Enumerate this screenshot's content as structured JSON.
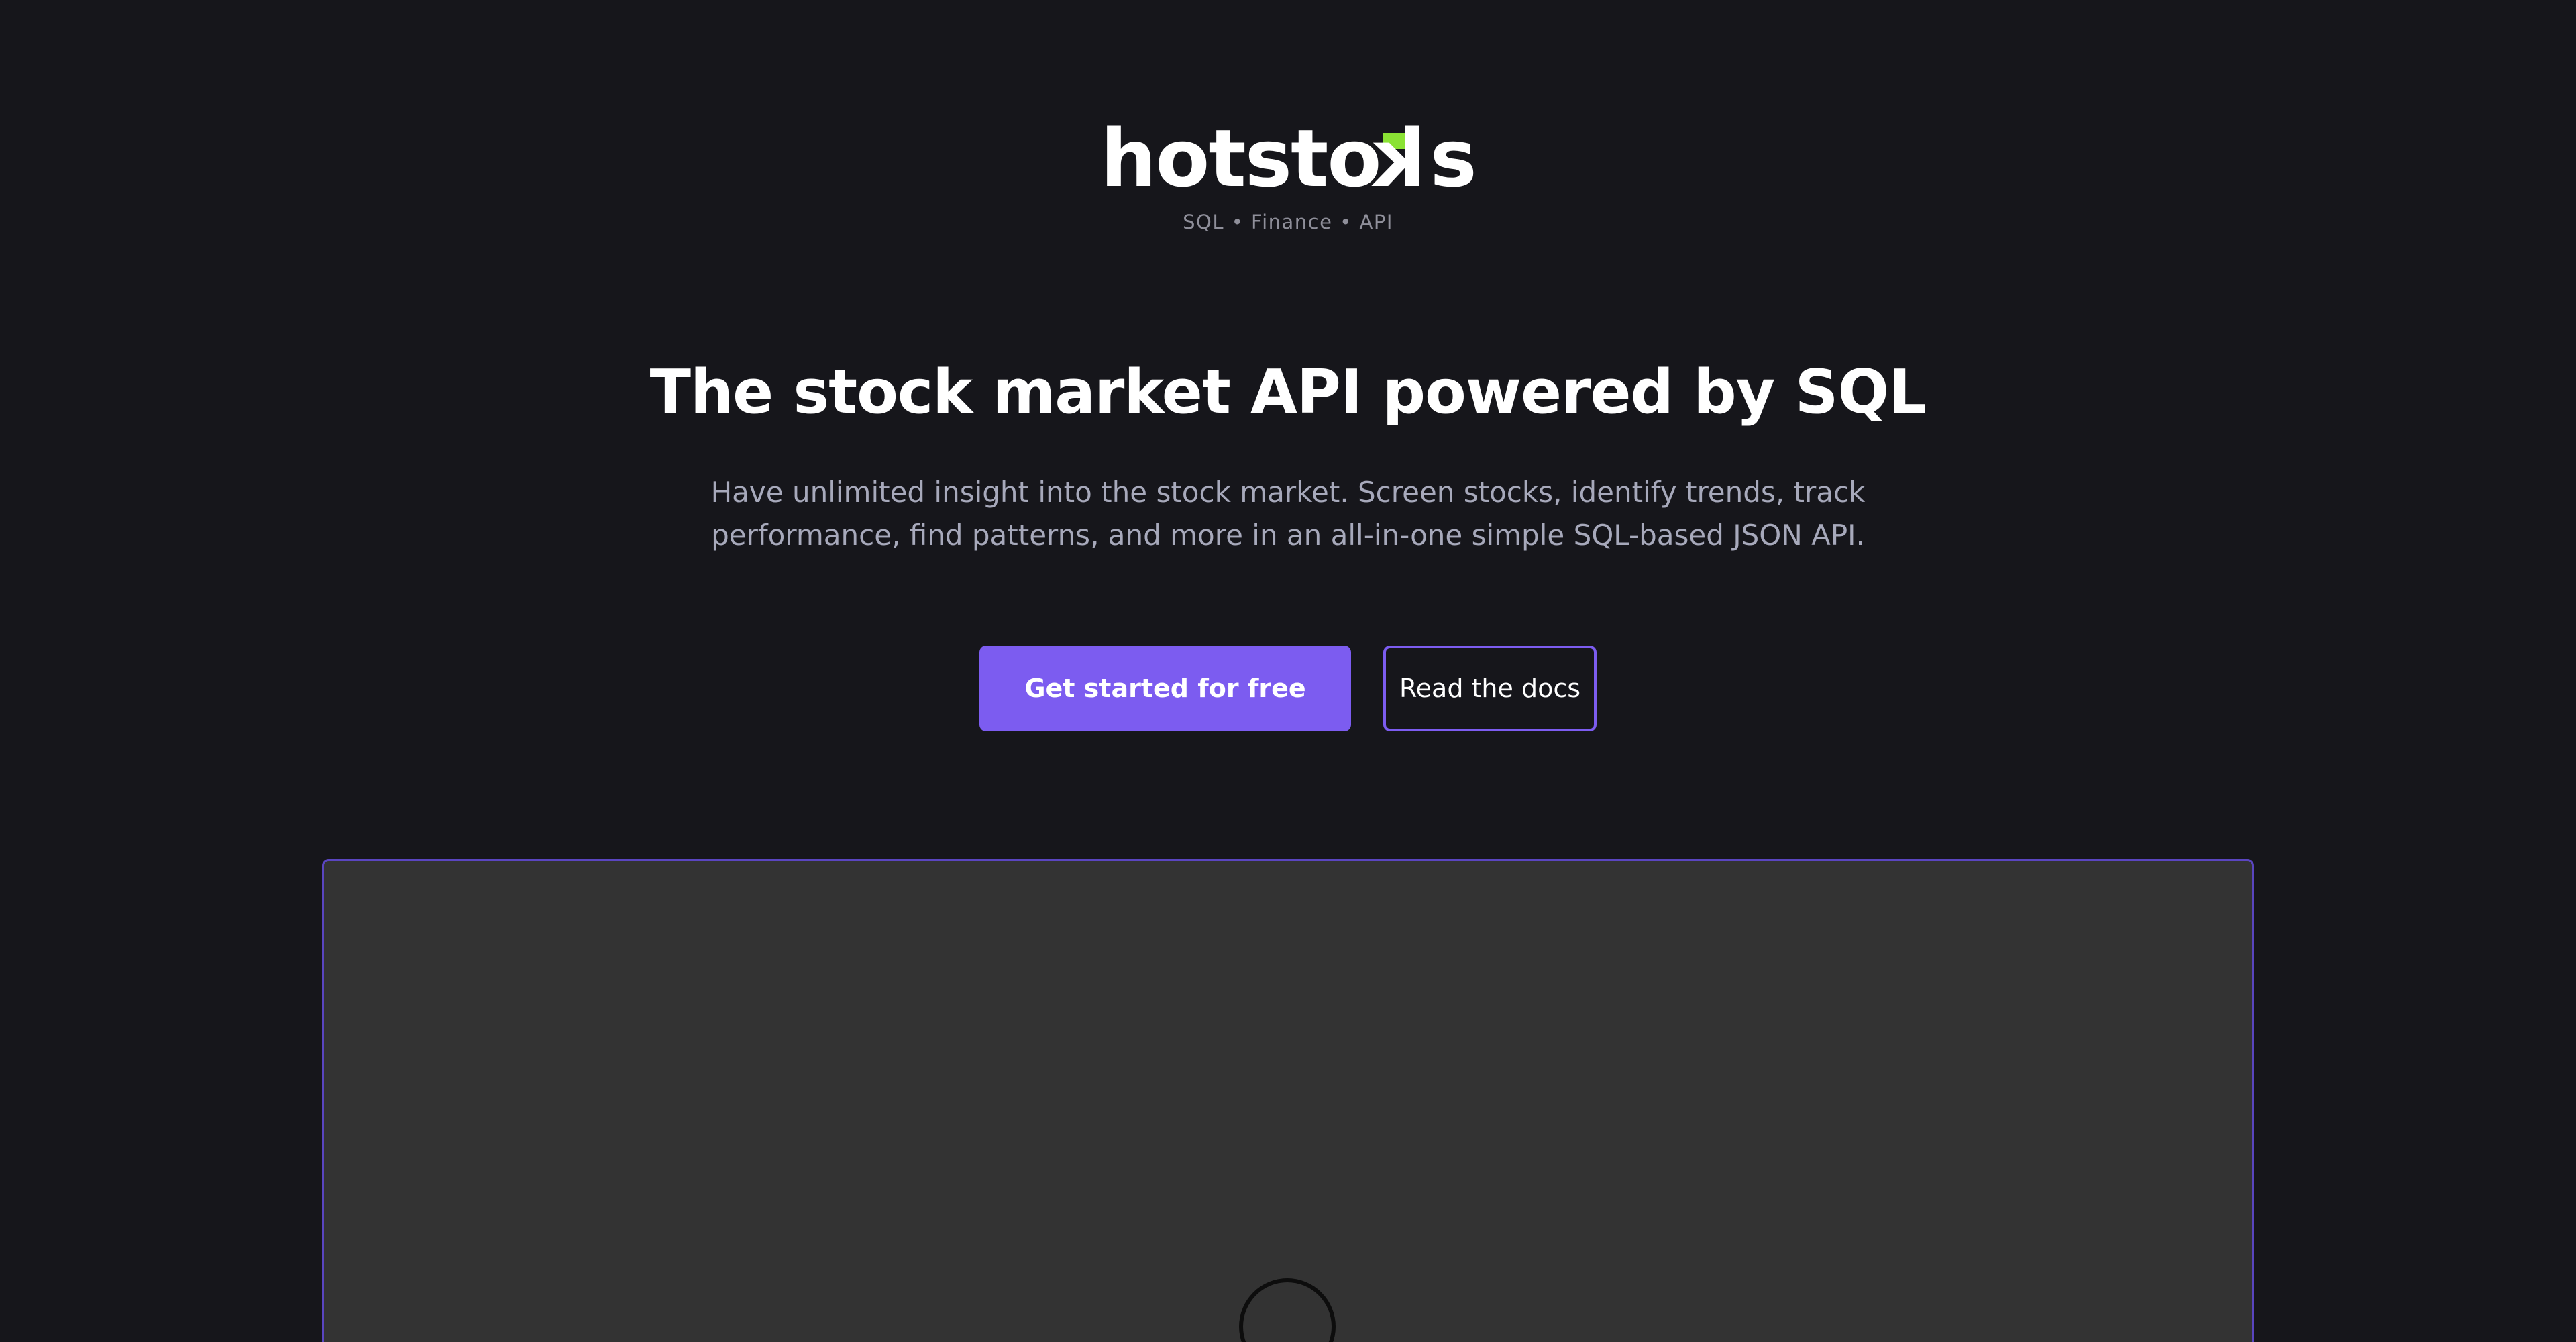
{
  "brand": {
    "logo_prefix": "hotsto",
    "logo_flipped_letter": "k",
    "logo_suffix": "s",
    "tagline": "SQL • Finance • API",
    "accent_color": "#8ae234"
  },
  "hero": {
    "headline": "The stock market API powered by SQL",
    "subtext": "Have unlimited insight into the stock market. Screen stocks, identify trends, track performance, find patterns, and more in an all-in-one simple SQL-based JSON API."
  },
  "cta": {
    "primary_label": "Get started for free",
    "secondary_label": "Read the docs",
    "primary_color": "#7c5cf0"
  },
  "demo": {
    "loading_icon": "spinner-icon",
    "background": "#333333"
  }
}
